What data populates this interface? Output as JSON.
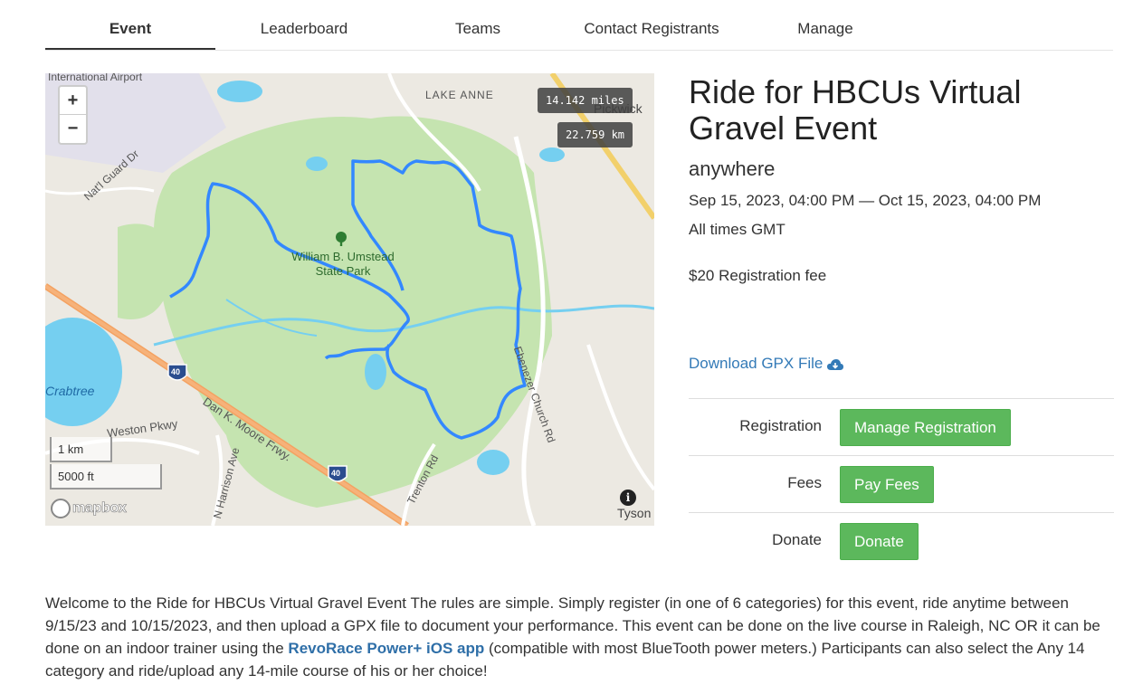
{
  "tabs": [
    {
      "label": "Event",
      "active": true
    },
    {
      "label": "Leaderboard",
      "active": false
    },
    {
      "label": "Teams",
      "active": false
    },
    {
      "label": "Contact Registrants",
      "active": false
    },
    {
      "label": "Manage",
      "active": false
    }
  ],
  "map": {
    "zoom_in": "+",
    "zoom_out": "−",
    "distance_miles": "14.142 miles",
    "distance_km": "22.759 km",
    "scale_km": "1 km",
    "scale_ft": "5000 ft",
    "attribution_logo": "mapbox",
    "info_icon": "i",
    "labels": {
      "airport": "International Airport",
      "lake_anne": "LAKE ANNE",
      "pickwick": "Pickwick",
      "natl_guard": "Nat'l Guard Dr",
      "park": "William B. Umstead State Park",
      "crabtree": "Crabtree",
      "weston": "Weston Pkwy",
      "dan_moore": "Dan K. Moore Frwy.",
      "harrison": "N Harrison Ave",
      "trenton": "Trenton Rd",
      "ebenezer": "Ebenezer Church Rd",
      "tyson": "Tyson",
      "i40_a": "40",
      "i40_b": "40"
    },
    "route_color": "#3388ff",
    "park_color": "#c5e4b0",
    "water_color": "#75cff0"
  },
  "event": {
    "title": "Ride for HBCUs Virtual Gravel Event",
    "location": "anywhere",
    "dates": "Sep 15, 2023, 04:00 PM — Oct 15, 2023, 04:00 PM",
    "timezone": "All times GMT",
    "fee": "$20 Registration fee",
    "gpx_link": "Download GPX File",
    "gpx_icon": "cloud-download-icon"
  },
  "actions": [
    {
      "label": "Registration",
      "button": "Manage Registration"
    },
    {
      "label": "Fees",
      "button": "Pay Fees"
    },
    {
      "label": "Donate",
      "button": "Donate"
    }
  ],
  "description": {
    "part1": "Welcome to the Ride for HBCUs Virtual Gravel Event  The rules are simple. Simply register (in one of 6 categories) for this event, ride anytime between 9/15/23 and 10/15/2023, and then upload a GPX file to document your performance. This event can be done on the live course in Raleigh, NC OR it can be done on an indoor trainer using the ",
    "link": "RevoRace Power+ iOS app",
    "part2": " (compatible with most BlueTooth power meters.)   Participants can also select the Any 14 category and ride/upload any 14-mile course of his or her choice!"
  },
  "colors": {
    "button_green": "#5cb85c",
    "link_blue": "#337ab7"
  }
}
